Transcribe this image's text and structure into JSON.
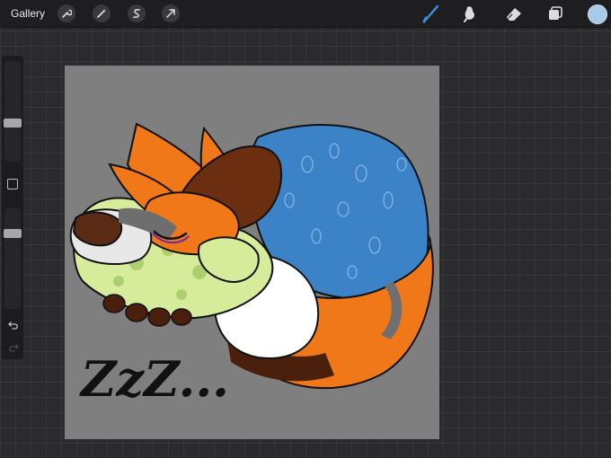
{
  "toolbar": {
    "gallery_label": "Gallery",
    "left_tools": [
      "wrench-icon",
      "magic-wand-icon",
      "selection-icon",
      "transform-arrow-icon"
    ],
    "right_tools": [
      "brush-icon",
      "smudge-icon",
      "eraser-icon",
      "layers-icon",
      "color-swatch"
    ],
    "active_tool": "brush",
    "accent_color": "#3e8ee8",
    "current_color": "#a9c9ea"
  },
  "sidebar": {
    "brush_size_level": 0.3,
    "opacity_level": 0.25,
    "undo_icon": "undo-icon",
    "redo_icon": "redo-icon"
  },
  "canvas": {
    "background_color": "#7f7f7f",
    "caption": "ZzZ..."
  }
}
